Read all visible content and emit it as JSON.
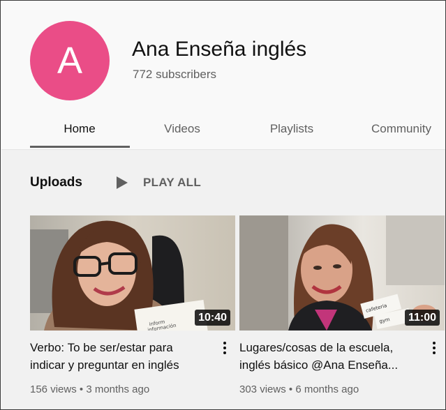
{
  "channel": {
    "avatar_letter": "A",
    "avatar_color": "#ea4d87",
    "name": "Ana Enseña inglés",
    "subscribers": "772 subscribers"
  },
  "tabs": [
    {
      "label": "Home",
      "active": true
    },
    {
      "label": "Videos",
      "active": false
    },
    {
      "label": "Playlists",
      "active": false
    },
    {
      "label": "Community",
      "active": false
    }
  ],
  "uploads": {
    "title": "Uploads",
    "play_all_label": "PLAY ALL",
    "play_icon": "play-icon"
  },
  "videos": [
    {
      "duration": "10:40",
      "title_line1": "Verbo: To be ser/estar para",
      "title_line2": "indicar y preguntar en inglés",
      "views": "156 views",
      "separator": "•",
      "age": "3 months ago",
      "menu_icon": "more-vert-icon"
    },
    {
      "duration": "11:00",
      "title_line1": "Lugares/cosas de la escuela,",
      "title_line2": "inglés básico @Ana Enseña...",
      "views": "303 views",
      "separator": "•",
      "age": "6 months ago",
      "menu_icon": "more-vert-icon"
    }
  ],
  "colors": {
    "accent": "#ea4d87",
    "text_primary": "#0f0f0f",
    "text_secondary": "#606060",
    "background": "#f9f9f9"
  }
}
